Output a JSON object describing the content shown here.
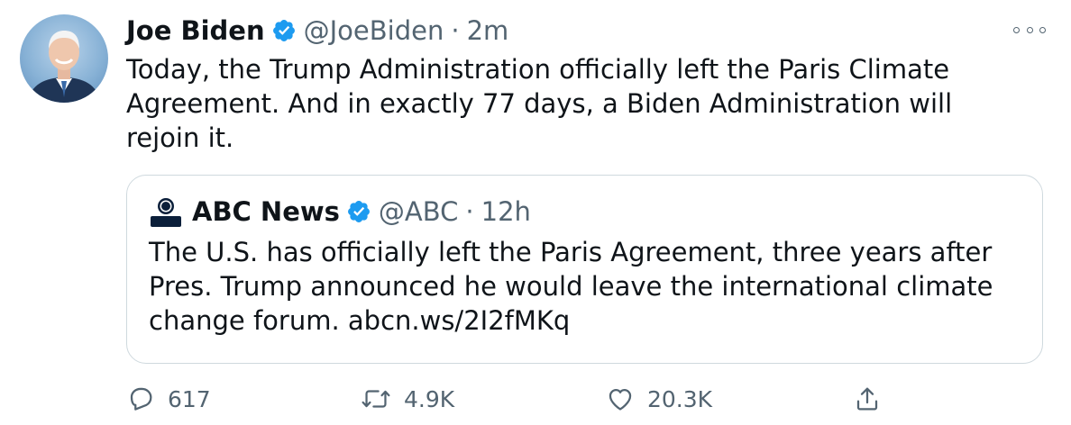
{
  "tweet": {
    "author_name": "Joe Biden",
    "author_handle": "@JoeBiden",
    "separator": "·",
    "timestamp": "2m",
    "text": "Today, the Trump Administration officially left the Paris Climate Agreement. And in exactly 77 days, a Biden Administration will rejoin it."
  },
  "quoted_tweet": {
    "author_name": "ABC News",
    "author_handle": "@ABC",
    "separator": "·",
    "timestamp": "12h",
    "text": "The U.S. has officially left the Paris Agreement, three years after Pres. Trump announced he would leave the international climate change forum. abcn.ws/2I2fMKq"
  },
  "actions": {
    "reply_count": "617",
    "retweet_count": "4.9K",
    "like_count": "20.3K"
  },
  "icons": {
    "avatar": "avatar",
    "verified": "verified-badge-icon",
    "more": "more-options-icon",
    "reply": "reply-icon",
    "retweet": "retweet-icon",
    "like": "heart-icon",
    "share": "share-icon",
    "quote_avatar": "abc-news-logo"
  },
  "colors": {
    "text": "#0f1419",
    "secondary": "#536471",
    "verified": "#1d9bf0",
    "border": "#cfd9de"
  }
}
